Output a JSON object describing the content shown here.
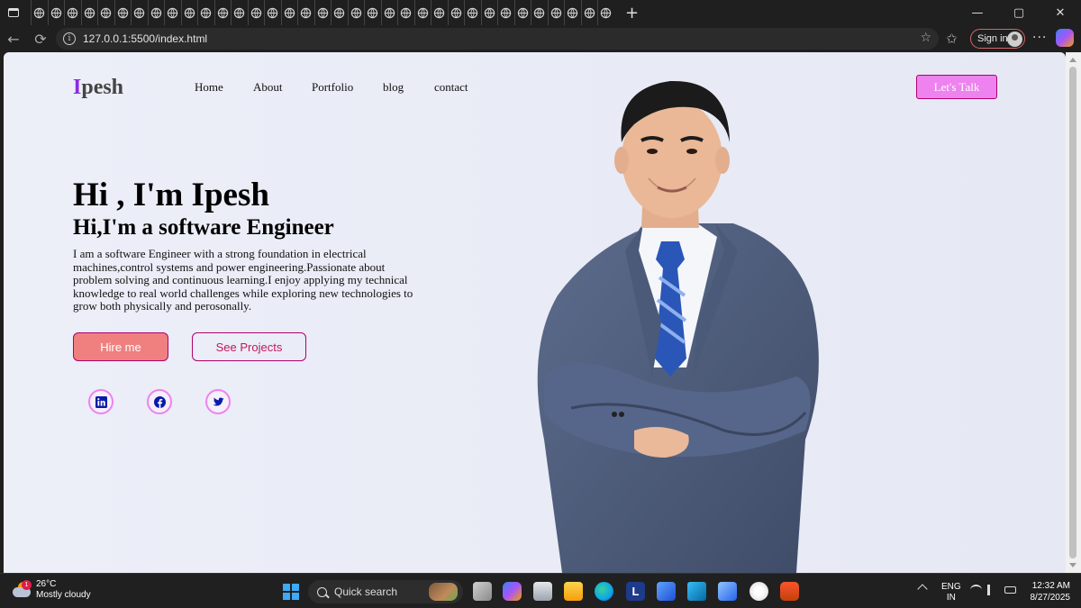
{
  "browser": {
    "url": "127.0.0.1:5500/index.html",
    "signin_label": "Sign in",
    "tab_count": 35
  },
  "page": {
    "logo_first": "I",
    "logo_rest": "pesh",
    "nav": [
      "Home",
      "About",
      "Portfolio",
      "blog",
      "contact"
    ],
    "cta": "Let's Talk",
    "hero_title": "Hi , I'm Ipesh",
    "hero_subtitle": "Hi,I'm a software Engineer",
    "hero_desc": "I am a software Engineer with a strong foundation in electrical machines,control systems and power engineering.Passionate about problem solving and continuous learning.I enjoy applying my technical knowledge to real world challenges while exploring new technologies to grow both physically and perosonally.",
    "btn_hire": "Hire me",
    "btn_projects": "See Projects",
    "social": [
      "linkedin-icon",
      "facebook-icon",
      "twitter-icon"
    ],
    "colors": {
      "accent": "#8a2be2",
      "cta_bg": "#ee82ee",
      "hire_bg": "#f08080",
      "border": "#b0006e"
    }
  },
  "taskbar": {
    "weather_temp": "26°C",
    "weather_desc": "Mostly cloudy",
    "weather_badge": "1",
    "search_placeholder": "Quick search",
    "lang_top": "ENG",
    "lang_bottom": "IN",
    "time": "12:32 AM",
    "date": "8/27/2025"
  }
}
